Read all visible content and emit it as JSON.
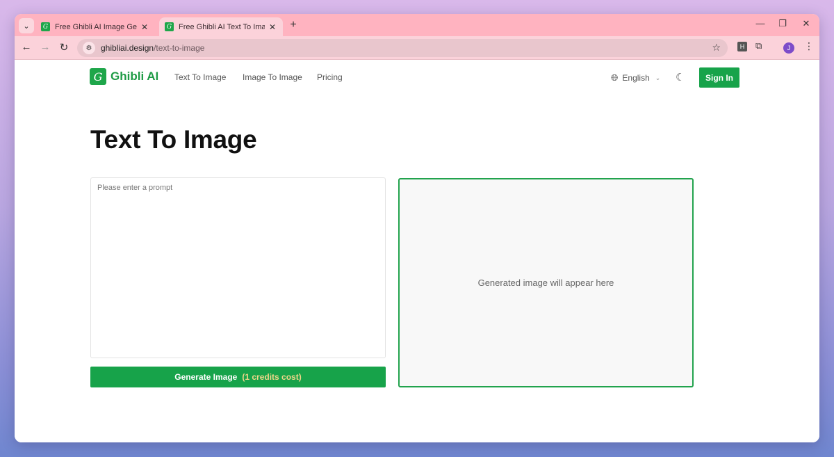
{
  "browser": {
    "tabs": [
      {
        "title": "Free Ghibli AI Image Generator",
        "favicon": "ghibli-logo-icon",
        "active": false
      },
      {
        "title": "Free Ghibli AI Text To Image Generator",
        "favicon": "ghibli-logo-icon",
        "active": true
      }
    ],
    "url": {
      "host": "ghibliai.design",
      "path": "/text-to-image"
    },
    "extension_label": "H",
    "profile_initial": "J"
  },
  "site": {
    "logo_text": "Ghibli AI",
    "nav": [
      "Text To Image",
      "Image To Image",
      "Pricing"
    ],
    "language": "English",
    "sign_in": "Sign In"
  },
  "main": {
    "title": "Text To Image",
    "prompt_placeholder": "Please enter a prompt",
    "generate_label": "Generate Image",
    "generate_cost": "(1 credits cost)",
    "preview_text": "Generated image will appear here"
  },
  "colors": {
    "brand_green": "#17a34a",
    "tab_strip": "#ffb3c0",
    "cost_text": "#f0d78a"
  }
}
